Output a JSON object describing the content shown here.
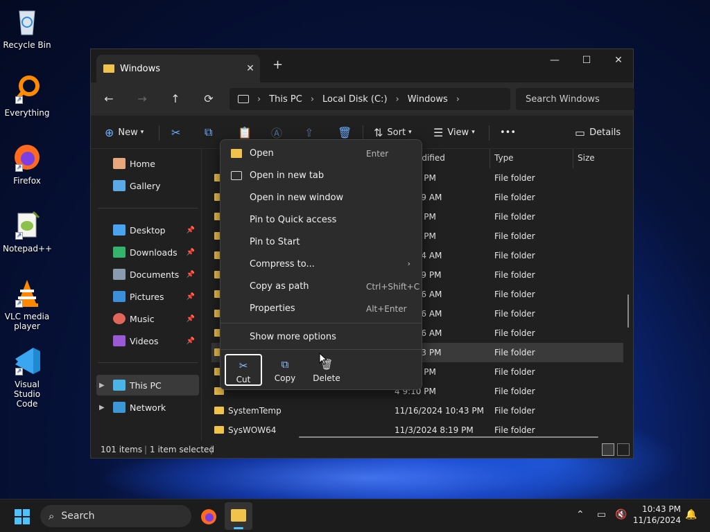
{
  "desktop": {
    "icons": [
      {
        "label": "Recycle Bin",
        "icon": "recycle-bin-icon"
      },
      {
        "label": "Everything",
        "icon": "everything-search-icon"
      },
      {
        "label": "Firefox",
        "icon": "firefox-icon"
      },
      {
        "label": "Notepad++",
        "icon": "notepadpp-icon"
      },
      {
        "label": "VLC media player",
        "icon": "vlc-icon"
      },
      {
        "label": "Visual Studio Code",
        "icon": "vscode-icon"
      }
    ]
  },
  "window": {
    "tab_title": "Windows",
    "new_tab": "+",
    "close_tab": "✕",
    "controls": {
      "minimize": "—",
      "maximize": "☐",
      "close": "✕"
    }
  },
  "nav": {
    "back": "←",
    "forward": "→",
    "up": "↑",
    "refresh": "⟳",
    "breadcrumb": [
      "This PC",
      "Local Disk (C:)",
      "Windows"
    ],
    "sep": "›",
    "search_placeholder": "Search Windows"
  },
  "toolbar": {
    "new_label": "New",
    "sort_label": "Sort",
    "view_label": "View",
    "more_label": "•••",
    "details_label": "Details"
  },
  "sidebar": {
    "top": [
      {
        "label": "Home",
        "icon": "home-icon"
      },
      {
        "label": "Gallery",
        "icon": "gallery-icon"
      }
    ],
    "quick": [
      {
        "label": "Desktop",
        "icon": "desktop-folder-icon"
      },
      {
        "label": "Downloads",
        "icon": "downloads-folder-icon"
      },
      {
        "label": "Documents",
        "icon": "documents-folder-icon"
      },
      {
        "label": "Pictures",
        "icon": "pictures-folder-icon"
      },
      {
        "label": "Music",
        "icon": "music-folder-icon"
      },
      {
        "label": "Videos",
        "icon": "videos-folder-icon"
      }
    ],
    "bottom": [
      {
        "label": "This PC",
        "icon": "this-pc-icon"
      },
      {
        "label": "Network",
        "icon": "network-icon"
      }
    ]
  },
  "columns": {
    "date": "odified",
    "type": "Type",
    "size": "Size"
  },
  "rows": [
    {
      "name": "",
      "date": "4 9:10 PM",
      "type": "File folder"
    },
    {
      "name": "",
      "date": "4 12:29 AM",
      "type": "File folder"
    },
    {
      "name": "",
      "date": "4 9:10 PM",
      "type": "File folder"
    },
    {
      "name": "",
      "date": "4 9:10 PM",
      "type": "File folder"
    },
    {
      "name": "",
      "date": "4 12:34 AM",
      "type": "File folder"
    },
    {
      "name": "",
      "date": "24 8:19 PM",
      "type": "File folder"
    },
    {
      "name": "",
      "date": "4 12:26 AM",
      "type": "File folder"
    },
    {
      "name": "",
      "date": "4 12:26 AM",
      "type": "File folder"
    },
    {
      "name": "",
      "date": "4 12:26 AM",
      "type": "File folder"
    },
    {
      "name": "",
      "date": "24 9:33 PM",
      "type": "File folder"
    },
    {
      "name": "",
      "date": "4 9:10 PM",
      "type": "File folder"
    },
    {
      "name": "",
      "date": "4 9:10 PM",
      "type": "File folder"
    },
    {
      "name": "SystemTemp",
      "date": "11/16/2024 10:43 PM",
      "type": "File folder"
    },
    {
      "name": "SysWOW64",
      "date": "11/3/2024 8:19 PM",
      "type": "File folder"
    }
  ],
  "status": {
    "items": "101 items",
    "selected": "1 item selected"
  },
  "context_menu": {
    "items": [
      {
        "label": "Open",
        "accel": "Enter"
      },
      {
        "label": "Open in new tab",
        "accel": ""
      },
      {
        "label": "Open in new window",
        "accel": ""
      },
      {
        "label": "Pin to Quick access",
        "accel": ""
      },
      {
        "label": "Pin to Start",
        "accel": ""
      },
      {
        "label": "Compress to...",
        "accel": ""
      },
      {
        "label": "Copy as path",
        "accel": "Ctrl+Shift+C"
      },
      {
        "label": "Properties",
        "accel": "Alt+Enter"
      }
    ],
    "more": "Show more options",
    "quick_actions": {
      "cut": "Cut",
      "copy": "Copy",
      "delete": "Delete"
    }
  },
  "taskbar": {
    "search": "Search",
    "time": "10:43 PM",
    "date": "11/16/2024"
  }
}
